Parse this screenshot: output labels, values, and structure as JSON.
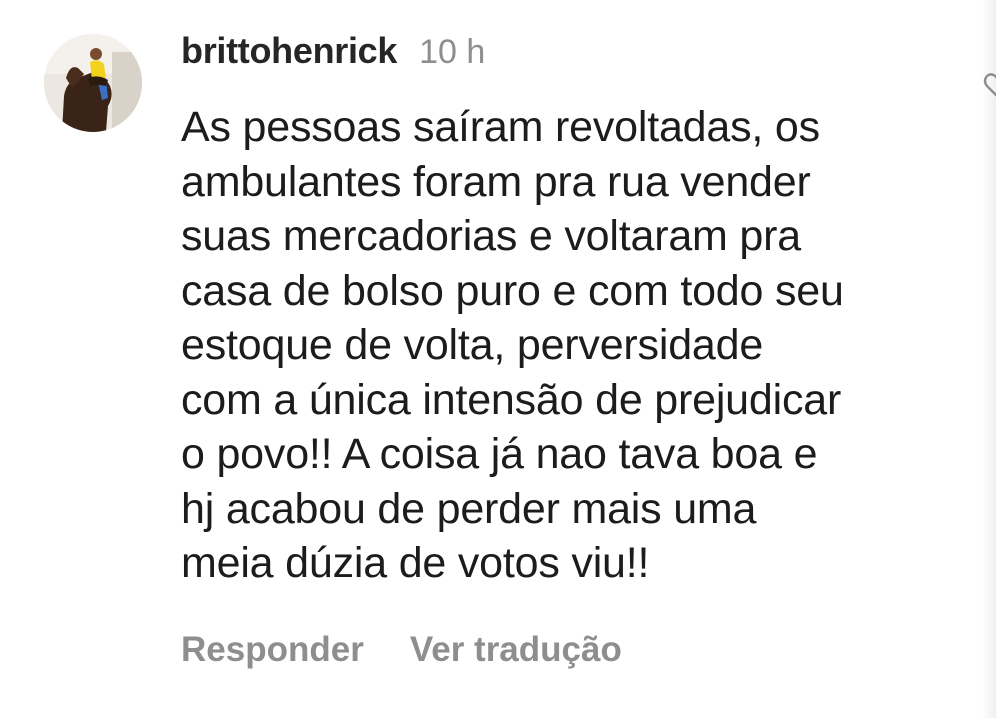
{
  "comment": {
    "username": "brittohenrick",
    "timestamp": "10 h",
    "text": "As pessoas saíram revoltadas, os\nambulantes foram pra rua vender\nsuas mercadorias e voltaram pra\ncasa de bolso puro e com todo seu\nestoque de volta, perversidade\ncom a única intensão de prejudicar\no povo!! A coisa já nao tava boa e\nhj acabou de perder mais uma\nmeia dúzia de votos viu!!",
    "actions": {
      "reply_label": "Responder",
      "translate_label": "Ver tradução"
    }
  },
  "icons": {
    "avatar": "profile-photo-horse-rider",
    "like": "heart-icon"
  },
  "colors": {
    "text": "#262626",
    "muted": "#8e8e8e",
    "background": "#ffffff"
  }
}
